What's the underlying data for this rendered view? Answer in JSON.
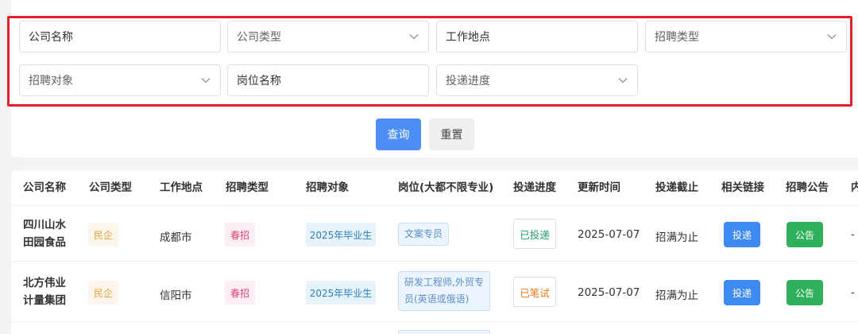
{
  "filters": {
    "company_name": "公司名称",
    "company_type": "公司类型",
    "work_location": "工作地点",
    "recruit_type": "招聘类型",
    "recruit_target": "招聘对象",
    "position_name": "岗位名称",
    "apply_progress": "投递进度"
  },
  "buttons": {
    "query": "查询",
    "reset": "重置"
  },
  "table": {
    "headers": [
      "公司名称",
      "公司类型",
      "工作地点",
      "招聘类型",
      "招聘对象",
      "岗位(大都不限专业)",
      "投递进度",
      "更新时间",
      "投递截止",
      "相关链接",
      "招聘公告",
      "内"
    ],
    "rows": [
      {
        "company_line1": "四川山水",
        "company_line2": "田园食品",
        "company_type": "民企",
        "location": "成都市",
        "recruit_type": "春招",
        "target": "2025年毕业生",
        "position": "文案专员",
        "progress": "已投递",
        "updated": "2025-07-07",
        "deadline": "招满为止",
        "apply_btn": "投递",
        "notice_btn": "公告",
        "extra": "-"
      },
      {
        "company_line1": "北方伟业",
        "company_line2": "计量集团",
        "company_type": "民企",
        "location": "信阳市",
        "recruit_type": "春招",
        "target": "2025年毕业生",
        "position": "研发工程师,外贸专员(英语或俄语)",
        "progress": "已笔试",
        "updated": "2025-07-07",
        "deadline": "招满为止",
        "apply_btn": "投递",
        "notice_btn": "公告",
        "extra": "-"
      }
    ]
  },
  "colors": {
    "primary": "#4e8ef7",
    "highlight_border": "#e0212b",
    "notice": "#2fb05a"
  }
}
